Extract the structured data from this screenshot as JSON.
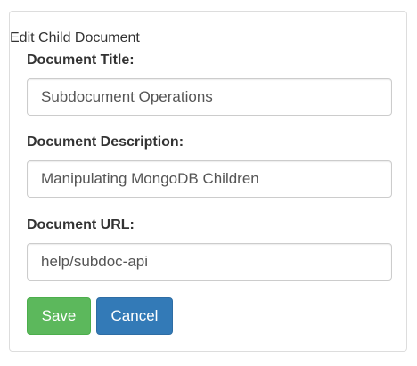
{
  "form": {
    "title": "Edit Child Document",
    "fields": [
      {
        "label": "Document Title:",
        "value": "Subdocument Operations"
      },
      {
        "label": "Document Description:",
        "value": "Manipulating MongoDB Children"
      },
      {
        "label": "Document URL:",
        "value": "help/subdoc-api"
      }
    ],
    "buttons": {
      "save": "Save",
      "cancel": "Cancel"
    }
  },
  "colors": {
    "save_button": "#5cb85c",
    "cancel_button": "#337ab7",
    "border": "#dddddd",
    "input_border": "#cccccc"
  }
}
